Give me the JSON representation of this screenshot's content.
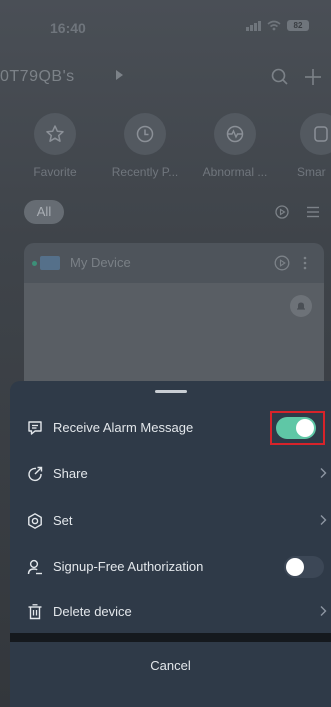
{
  "status_bar": {
    "time": "16:40",
    "battery": "82"
  },
  "home": {
    "title": "0T79QB's",
    "quick_actions": [
      {
        "label": "Favorite",
        "icon": "star-icon"
      },
      {
        "label": "Recently P...",
        "icon": "clock-icon"
      },
      {
        "label": "Abnormal ...",
        "icon": "heartbeat-icon"
      },
      {
        "label": "Smar",
        "icon": "smart-icon"
      }
    ],
    "filter_all": "All",
    "device_name": "My Device"
  },
  "sheet": {
    "items": [
      {
        "label": "Receive Alarm Message",
        "icon": "message-icon",
        "control": "toggle",
        "toggle_on": true
      },
      {
        "label": "Share",
        "icon": "share-icon",
        "control": "chevron"
      },
      {
        "label": "Set",
        "icon": "settings-icon",
        "control": "chevron"
      },
      {
        "label": "Signup-Free Authorization",
        "icon": "user-key-icon",
        "control": "toggle",
        "toggle_on": false
      },
      {
        "label": "Delete device",
        "icon": "trash-icon",
        "control": "chevron"
      }
    ],
    "cancel_label": "Cancel"
  },
  "colors": {
    "sheet_background": "#2f3a48",
    "toggle_on": "#5fc7a6",
    "highlight": "#d8232a"
  }
}
